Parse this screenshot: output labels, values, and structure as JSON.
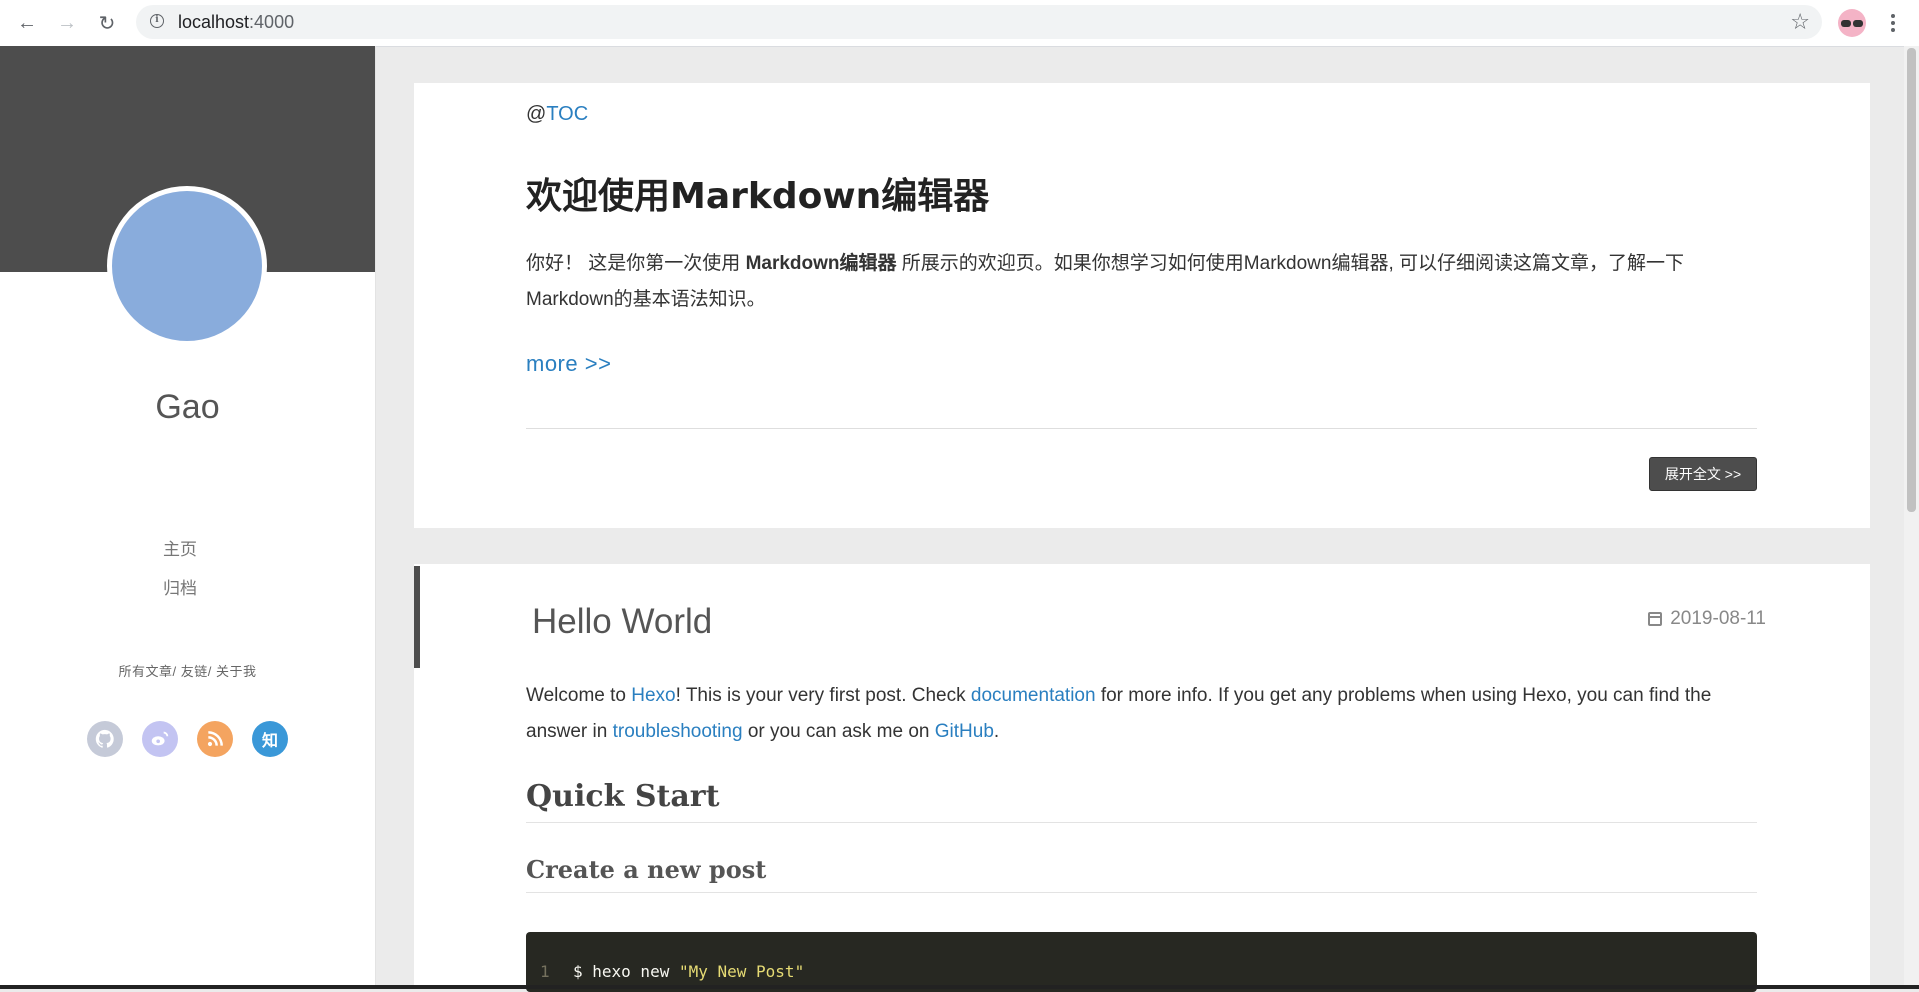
{
  "browser": {
    "url_host": "localhost",
    "url_port": ":4000"
  },
  "sidebar": {
    "author": "Gao",
    "nav": [
      {
        "label": "主页"
      },
      {
        "label": "归档"
      }
    ],
    "links": [
      {
        "label": "所有文章"
      },
      {
        "label": "友链"
      },
      {
        "label": "关于我"
      }
    ],
    "social": [
      {
        "icon": "github-icon"
      },
      {
        "icon": "weibo-icon"
      },
      {
        "icon": "rss-icon"
      },
      {
        "icon": "zhihu-icon",
        "text": "知"
      }
    ]
  },
  "post1": {
    "toc_prefix": "@",
    "toc_link": "TOC",
    "title": "欢迎使用Markdown编辑器",
    "intro_a": "你好！ 这是你第一次使用 ",
    "intro_bold": "Markdown编辑器",
    "intro_b": " 所展示的欢迎页。如果你想学习如何使用Markdown编辑器, 可以仔细阅读这篇文章，了解一下Markdown的基本语法知识。",
    "more": "more >>",
    "expand": "展开全文 >>"
  },
  "post2": {
    "title": "Hello World",
    "date": "2019-08-11",
    "p_a": "Welcome to ",
    "link_hexo": "Hexo",
    "p_b": "! This is your very first post. Check ",
    "link_docs": "documentation",
    "p_c": " for more info. If you get any problems when using Hexo, you can find the answer in ",
    "link_trouble": "troubleshooting",
    "p_d": " or you can ask me on ",
    "link_github": "GitHub",
    "p_e": ".",
    "h2": "Quick Start",
    "h3": "Create a new post",
    "code_line_no": "1",
    "code_cmd": "$ hexo new ",
    "code_str": "\"My New Post\""
  },
  "colors": {
    "link": "#2a7fc0",
    "banner": "#4d4d4d",
    "avatar": "#89acdc"
  }
}
